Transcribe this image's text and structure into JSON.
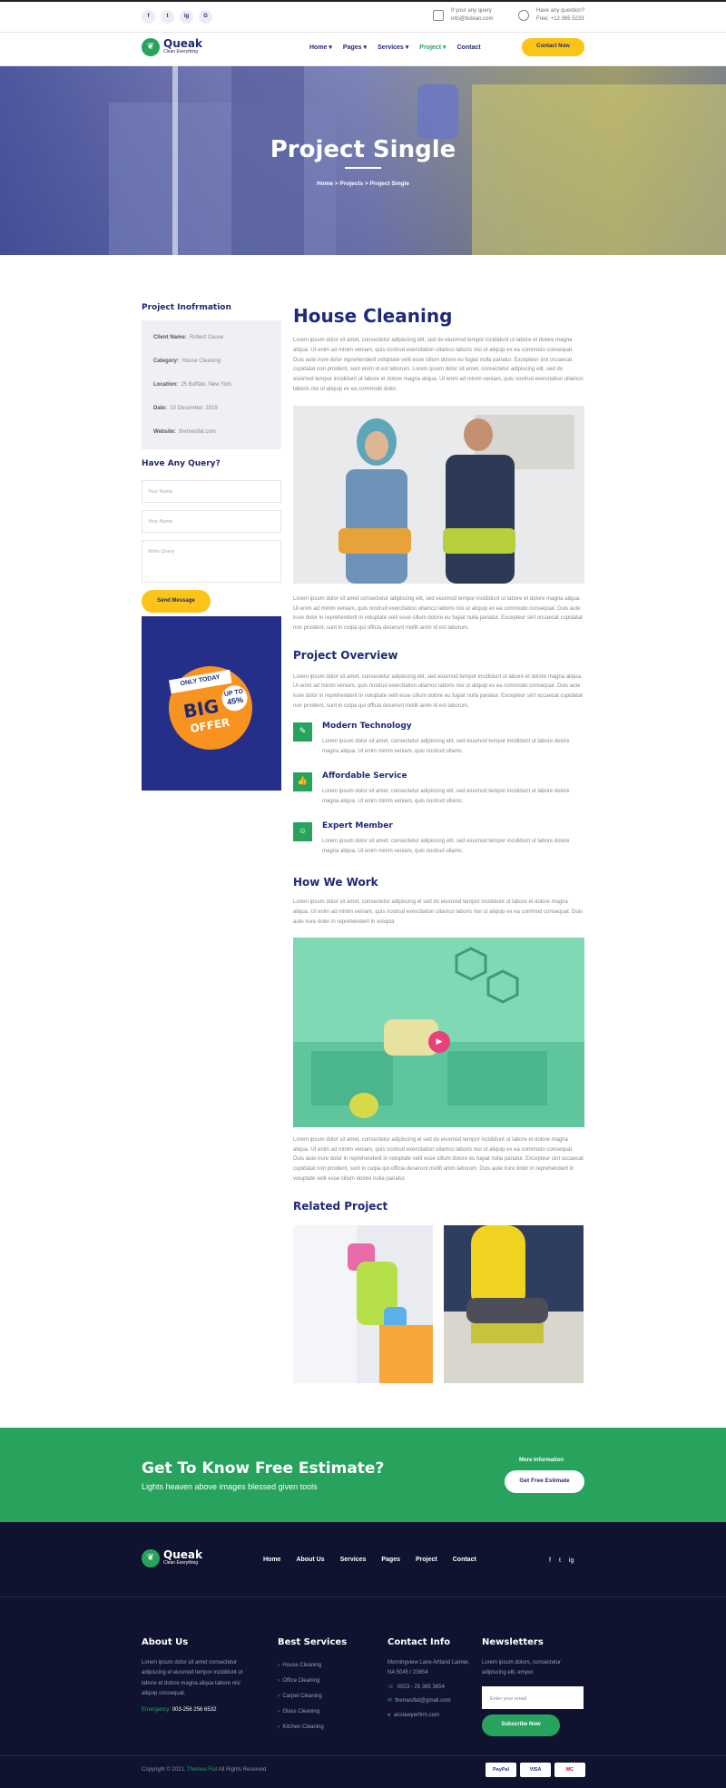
{
  "topbar": {
    "social": [
      "f",
      "t",
      "ig",
      "G"
    ],
    "query_label": "If your any query",
    "query_email": "info@bclean.com",
    "question_label": "Have any question?",
    "question_phone": "Free: +12 365 5233"
  },
  "header": {
    "logo_name": "Queak",
    "logo_tagline": "Clean Everything",
    "nav": [
      "Home",
      "Pages",
      "Services",
      "Project",
      "Contact"
    ],
    "contact_btn": "Contact Now"
  },
  "hero": {
    "title": "Project Single",
    "breadcrumb": [
      "Home",
      "Projects",
      "Project Single"
    ]
  },
  "sidebar": {
    "info_title": "Project Inofrmation",
    "info": [
      {
        "k": "Client Name:",
        "v": "Robert Cause"
      },
      {
        "k": "Category:",
        "v": "House Cleaning"
      },
      {
        "k": "Location:",
        "v": "25 Buffalo, New York"
      },
      {
        "k": "Date:",
        "v": "10 December, 2019"
      },
      {
        "k": "Website:",
        "v": "themesflat.com"
      }
    ],
    "query_title": "Have Any Query?",
    "name_ph": "Your Name",
    "name2_ph": "Your Name",
    "msg_ph": "Write Query",
    "send": "Send Message",
    "offer": {
      "line1": "ONLY TODAY",
      "big": "BIG",
      "offer": "OFFER",
      "upto": "UP TO",
      "pct": "45%"
    }
  },
  "content": {
    "title": "House Cleaning",
    "p1": "Lorem ipsum dolor sit amet, consectetur adipiscing elit, sed do eiusmod tempor incididunt ut labore et dolore magna aliqua. Ut enim ad minim veniam, quis nostrud exercitation ullamco laboris nisi ut aliquip ex ea commodo consequat. Duis aute irure dolor reprehenderit voluptate velit esse cillum dolore eu fugiat nulla pariatur. Excepteur sint occaecat cupidatat non proident, sunt enim id est laborum. Lorem ipsum dolor sit amet, consectetur adipiscing elit, sed do eiusmod tempor incididunt ut labore et dolore magna aliqua. Ut enim ad minim veniam, quis nostrud exercitation ullamco laboris nisi ut aliquip ex ea commodo dolor.",
    "p2": "Lorem ipsum dolor sit amet consectetur adipiscing elit, sed eiusmod tempor incididunt ut labore et dolore magna aliqua. Ut enim ad minim veniam, quis nostrud exercitation ullamco laboris nisi ut aliquip ex ea commodo consequat. Duis aute irure dolor in reprehenderit in voluptate velit esse cillum dolore eu fugiat nulla pariatur. Excepteur sint occaecat cupidatat non proident, sunt in culpa qui officia deserunt mollit anim id est laborum.",
    "overview_title": "Project Overview",
    "p3": "Lorem ipsum dolor sit amet, consectetur adipiscing elit, sed eiusmod tempor incididunt ut labore et dolore magna aliqua. Ut enim ad minim veniam, quis nostrud exercitation ullamco laboris nisi ut aliquip ex ea commodo consequat. Duis aute irure dolor in reprehenderit in voluptate velit esse cillum dolore eu fugiat nulla pariatur. Excepteur sint occaecat cupidatat non proident, sunt in culpa qui officia deserunt mollit anim id est laborum.",
    "features": [
      {
        "title": "Modern Technology",
        "text": "Lorem ipsum dolor sit amet, consectetur adipiscing elit, sed eiusmod tempor incididunt ut labore dolore magna aliqua. Ut enim minim veniam, quis nostrud ullamc."
      },
      {
        "title": "Affordable Service",
        "text": "Lorem ipsum dolor sit amet, consectetur adipiscing elit, sed eiusmod tempor incididunt ut labore dolore magna aliqua. Ut enim minim veniam, quis nostrud ullamc."
      },
      {
        "title": "Expert Member",
        "text": "Lorem ipsum dolor sit amet, consectetur adipiscing elit, sed eiusmod tempor incididunt ut labore dolore magna aliqua. Ut enim minim veniam, quis nostrud ullamc."
      }
    ],
    "how_title": "How We Work",
    "p4": "Lorem ipsum dolor sit amet, consectetur adipiscing el sed do eiusmod tempor incididunt ut labore et dolore magna aliqua. Ut enim ad minim veniam, quis nostrud exercitation ullamco laboris nisi ut aliquip ex ea commod consequat. Duis aute irure dolor in reprehenderit in volupta",
    "p5": "Lorem ipsum dolor sit amet, consectetur adipiscing el sed do eiusmod tempor incididunt ut labore et dolore magna aliqua. Ut enim ad minim veniam, quis nostrud exercitation ullamco laboris nisi ut aliquip ex ea commodo consequat. Duis aute irure dolor in reprehenderit in voluptate velit esse cillum dolore eu fugiat nulla pariatur. Excepteur sint occaecat cupidatat non proident, sunt in culpa qui officia deserunt mollit anim laborum. Duis aute irure dolor in reprehenderit in voluptate velit esse cillum dolore nulla pariatur.",
    "related_title": "Related Project"
  },
  "cta": {
    "title": "Get To Know Free Estimate?",
    "sub": "Lights heaven above images blessed given tools",
    "more": "More Information",
    "btn": "Get Free Estimate"
  },
  "footer": {
    "logo_name": "Queak",
    "logo_tagline": "Clean Everything",
    "nav": [
      "Home",
      "About Us",
      "Services",
      "Pages",
      "Project",
      "Contact"
    ],
    "social": [
      "f",
      "t",
      "ig"
    ],
    "about_title": "About Us",
    "about_text": "Lorem ipsum dolor sit amet consectetur adipiscing el eiusmod tempor incididunt ut labore et dolore magna aliqua tabore nisi aliquip consequat.",
    "emergency_label": "Emergency:",
    "emergency_phone": "003-256 256 6532",
    "services_title": "Best Services",
    "services": [
      "House Cleaning",
      "Office Cleaning",
      "Carpet Cleaning",
      "Glass Cleaning",
      "Kitchen Cleaning"
    ],
    "contact_title": "Contact Info",
    "address": "Morningview Lane Artland Laimer, NA 5045 / 23654",
    "phone": "0023 - 25 365 3654",
    "email": "themesflat@gmail.com",
    "web": "anslawyerfirm.com",
    "news_title": "Newsletters",
    "news_text": "Lorem ipsum dolors, consectetur adipiscing elit, empor.",
    "news_ph": "Enter your email",
    "news_btn": "Subscribe Now",
    "copy_pre": "Copyright © 2021.",
    "copy_brand": "Themes Flat",
    "copy_post": "All Rights Reserved",
    "payments": [
      "PayPal",
      "VISA",
      "MC"
    ]
  }
}
